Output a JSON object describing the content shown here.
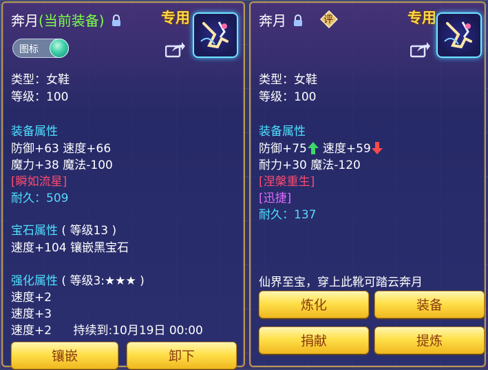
{
  "left": {
    "title_name": "奔月",
    "title_status": "(当前装备)",
    "exclusive": "专用",
    "toggle_label": "图标",
    "type": "类型：女鞋",
    "level": "等级：100",
    "attr_header": "装备属性",
    "attr1": "防御+63 速度+66",
    "attr2": "魔力+38 魔法-100",
    "special": "[瞬如流星]",
    "durability_label": "耐久：",
    "durability_value": "509",
    "gem_header": "宝石属性",
    "gem_level": "( 等级13 )",
    "gem_attr": "速度+104 镶嵌黑宝石",
    "enhance_header": "强化属性",
    "enhance_level": "( 等级3:★★★ )",
    "enh1": "速度+2",
    "enh2": "速度+3",
    "enh3": "速度+2",
    "enh3_duration": "持续到:10月19日 00:00",
    "btn_inlay": "镶嵌",
    "btn_unequip": "卸下"
  },
  "right": {
    "title_name": "奔月",
    "rate_badge": "评",
    "exclusive": "专用",
    "type": "类型：女鞋",
    "level": "等级：100",
    "attr_header": "装备属性",
    "attr1a": "防御+75",
    "attr1b": "速度+59",
    "attr2": "耐力+30 魔法-120",
    "special1": "[涅槃重生]",
    "special2": "[迅捷]",
    "durability_label": "耐久：",
    "durability_value": "137",
    "description": "仙界至宝，穿上此靴可踏云奔月",
    "btn_refine": "炼化",
    "btn_equip": "装备",
    "btn_donate": "捐献",
    "btn_extract": "提炼"
  },
  "colors": {
    "accent_gold": "#ffd84a",
    "section_cyan": "#4de1ff",
    "special_red": "#ff4a6e",
    "special_purple": "#e06bff",
    "status_green": "#7cff4a"
  },
  "icons": [
    "lock-icon",
    "share-icon",
    "boots-item-icon",
    "arrow-up-icon",
    "arrow-down-icon",
    "rate-badge-icon"
  ]
}
